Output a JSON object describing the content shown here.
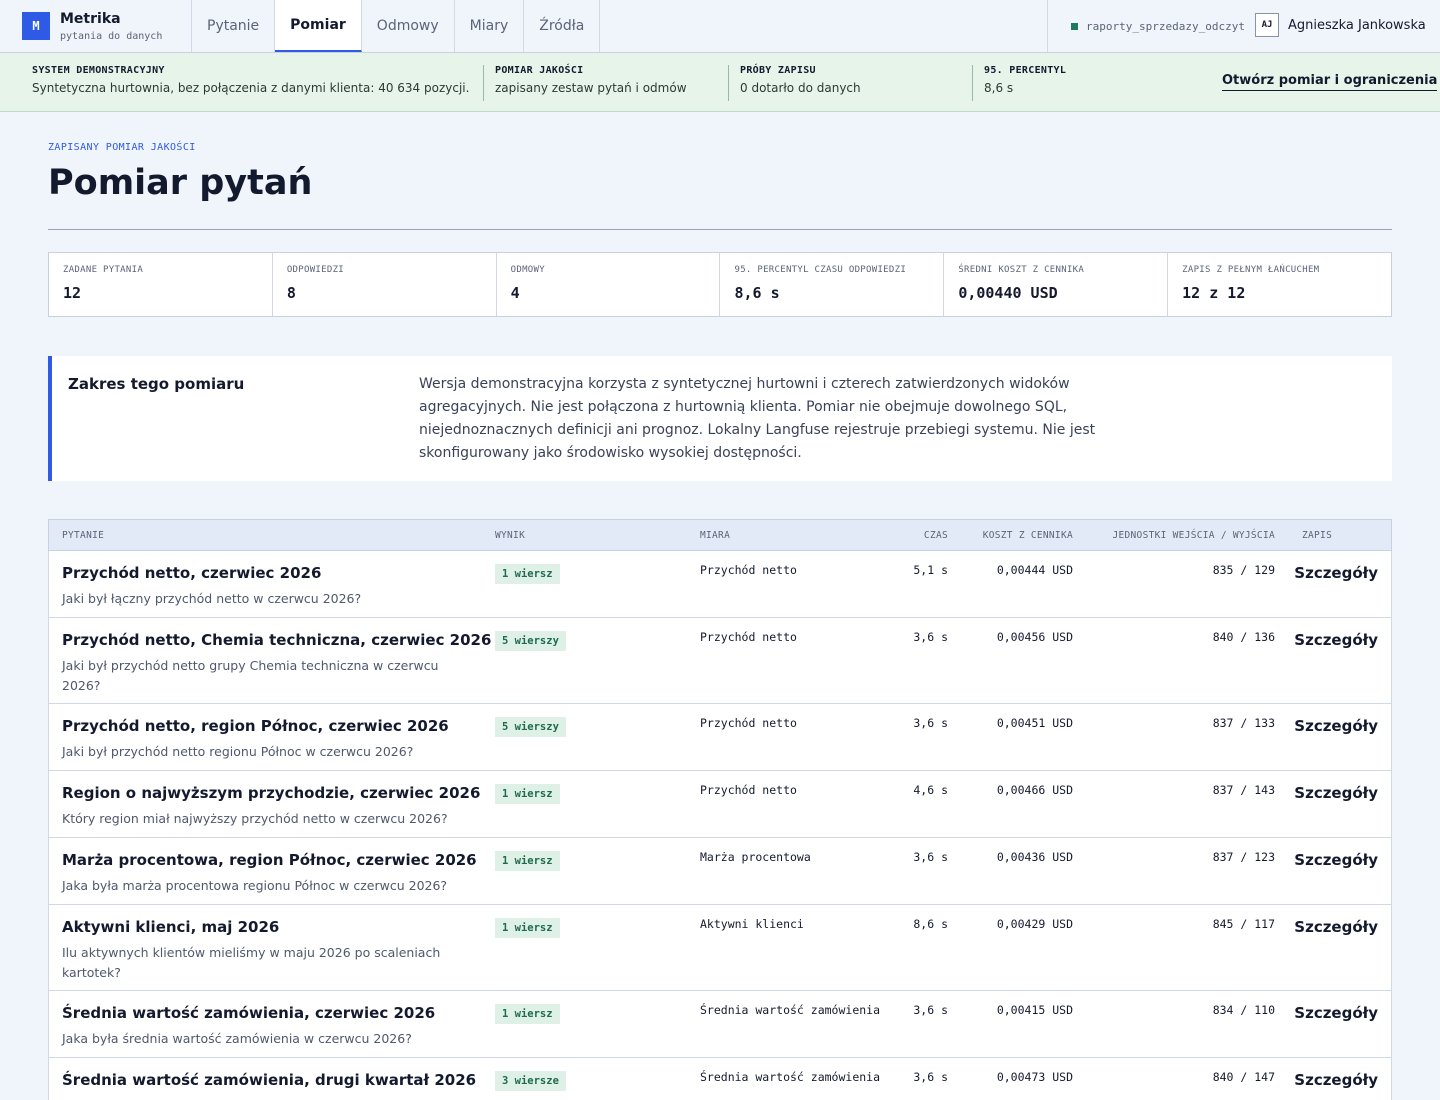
{
  "app": {
    "logo_letter": "M",
    "name": "Metrika",
    "tagline": "pytania do danych",
    "connection": "raporty_sprzedazy_odczyt",
    "user_initials": "AJ",
    "user_name": "Agnieszka Jankowska"
  },
  "nav": [
    "Pytanie",
    "Pomiar",
    "Odmowy",
    "Miary",
    "Źródła"
  ],
  "nav_active": "Pomiar",
  "status": {
    "system_label": "SYSTEM DEMONSTRACYJNY",
    "system_value": "Syntetyczna hurtownia, bez połączenia z danymi klienta: 40 634 pozycji.",
    "quality_label": "POMIAR JAKOŚCI",
    "quality_value": "zapisany zestaw pytań i odmów",
    "attempts_label": "PRÓBY ZAPISU",
    "attempts_value": "0 dotarło do danych",
    "percentile_label": "95. PERCENTYL",
    "percentile_value": "8,6 s",
    "link": "Otwórz pomiar i ograniczenia"
  },
  "page": {
    "eyebrow": "ZAPISANY POMIAR JAKOŚCI",
    "title": "Pomiar pytań"
  },
  "stats": [
    {
      "label": "ZADANE PYTANIA",
      "value": "12"
    },
    {
      "label": "ODPOWIEDZI",
      "value": "8"
    },
    {
      "label": "ODMOWY",
      "value": "4"
    },
    {
      "label": "95. PERCENTYL CZASU ODPOWIEDZI",
      "value": "8,6 s"
    },
    {
      "label": "ŚREDNI KOSZT Z CENNIKA",
      "value": "0,00440 USD"
    },
    {
      "label": "ZAPIS Z PEŁNYM ŁAŃCUCHEM",
      "value": "12 z 12"
    }
  ],
  "scope": {
    "title": "Zakres tego pomiaru",
    "text": "Wersja demonstracyjna korzysta z syntetycznej hurtowni i czterech zatwierdzonych widoków agregacyjnych. Nie jest połączona z hurtownią klienta. Pomiar nie obejmuje dowolnego SQL, niejednoznacznych definicji ani prognoz. Lokalny Langfuse rejestruje przebiegi systemu. Nie jest skonfigurowany jako środowisko wysokiej dostępności."
  },
  "table": {
    "headers": {
      "question": "PYTANIE",
      "result": "WYNIK",
      "measure": "MIARA",
      "time": "CZAS",
      "cost": "KOSZT Z CENNIKA",
      "tokens": "JEDNOSTKI WEJŚCIA / WYJŚCIA",
      "record": "ZAPIS"
    },
    "rows": [
      {
        "title": "Przychód netto, czerwiec 2026",
        "question": "Jaki był łączny przychód netto w czerwcu 2026?",
        "result": "1 wiersz",
        "measure": "Przychód netto",
        "time": "5,1 s",
        "cost": "0,00444 USD",
        "tokens": "835 / 129",
        "details": "Szczegóły"
      },
      {
        "title": "Przychód netto, Chemia techniczna, czerwiec 2026",
        "question": "Jaki był przychód netto grupy Chemia techniczna w czerwcu 2026?",
        "result": "5 wierszy",
        "measure": "Przychód netto",
        "time": "3,6 s",
        "cost": "0,00456 USD",
        "tokens": "840 / 136",
        "details": "Szczegóły"
      },
      {
        "title": "Przychód netto, region Północ, czerwiec 2026",
        "question": "Jaki był przychód netto regionu Północ w czerwcu 2026?",
        "result": "5 wierszy",
        "measure": "Przychód netto",
        "time": "3,6 s",
        "cost": "0,00451 USD",
        "tokens": "837 / 133",
        "details": "Szczegóły"
      },
      {
        "title": "Region o najwyższym przychodzie, czerwiec 2026",
        "question": "Który region miał najwyższy przychód netto w czerwcu 2026?",
        "result": "1 wiersz",
        "measure": "Przychód netto",
        "time": "4,6 s",
        "cost": "0,00466 USD",
        "tokens": "837 / 143",
        "details": "Szczegóły"
      },
      {
        "title": "Marża procentowa, region Północ, czerwiec 2026",
        "question": "Jaka była marża procentowa regionu Północ w czerwcu 2026?",
        "result": "1 wiersz",
        "measure": "Marża procentowa",
        "time": "3,6 s",
        "cost": "0,00436 USD",
        "tokens": "837 / 123",
        "details": "Szczegóły"
      },
      {
        "title": "Aktywni klienci, maj 2026",
        "question": "Ilu aktywnych klientów mieliśmy w maju 2026 po scaleniach kartotek?",
        "result": "1 wiersz",
        "measure": "Aktywni klienci",
        "time": "8,6 s",
        "cost": "0,00429 USD",
        "tokens": "845 / 117",
        "details": "Szczegóły"
      },
      {
        "title": "Średnia wartość zamówienia, czerwiec 2026",
        "question": "Jaka była średnia wartość zamówienia w czerwcu 2026?",
        "result": "1 wiersz",
        "measure": "Średnia wartość zamówienia",
        "time": "3,6 s",
        "cost": "0,00415 USD",
        "tokens": "834 / 110",
        "details": "Szczegóły"
      },
      {
        "title": "Średnia wartość zamówienia, drugi kwartał 2026",
        "question": "",
        "result": "3 wiersze",
        "measure": "Średnia wartość zamówienia",
        "time": "3,6 s",
        "cost": "0,00473 USD",
        "tokens": "840 / 147",
        "details": "Szczegóły"
      }
    ]
  }
}
